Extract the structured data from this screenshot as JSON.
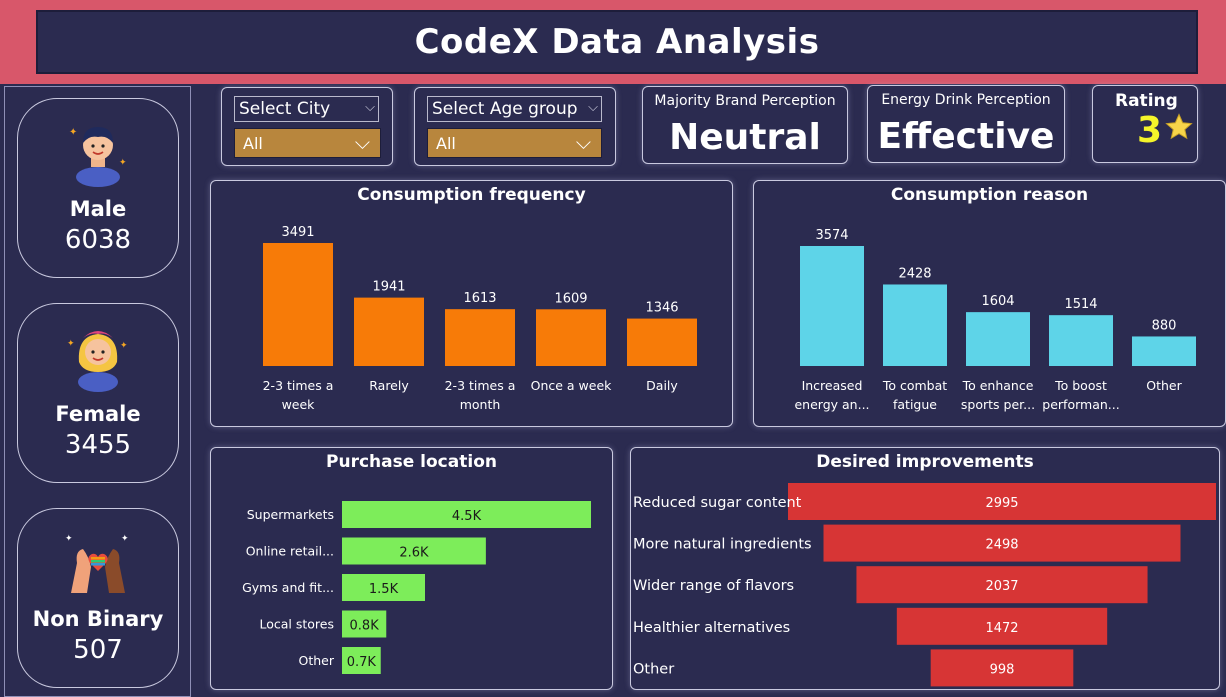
{
  "header": {
    "title": "CodeX Data Analysis"
  },
  "genders": [
    {
      "label": "Male",
      "value": "6038"
    },
    {
      "label": "Female",
      "value": "3455"
    },
    {
      "label": "Non Binary",
      "value": "507"
    }
  ],
  "filters": {
    "city": {
      "label": "Select City",
      "value": "All"
    },
    "age": {
      "label": "Select Age group",
      "value": "All"
    }
  },
  "kpis": {
    "brand": {
      "label": "Majority Brand Perception",
      "value": "Neutral"
    },
    "energy": {
      "label": "Energy Drink Perception",
      "value": "Effective"
    },
    "rating": {
      "label": "Rating",
      "value": "3",
      "icon": "star-icon"
    }
  },
  "colors": {
    "frequency": "#f77b08",
    "reason": "#5ed4e8",
    "location": "#7ded5a",
    "improvements": "#d73535"
  },
  "chart_data": [
    {
      "id": "frequency",
      "type": "bar",
      "title": "Consumption frequency",
      "categories": [
        "2-3 times a week",
        "Rarely",
        "2-3 times a month",
        "Once a week",
        "Daily"
      ],
      "category_lines": [
        [
          "2-3 times a",
          "week"
        ],
        [
          "Rarely"
        ],
        [
          "2-3 times a",
          "month"
        ],
        [
          "Once a week"
        ],
        [
          "Daily"
        ]
      ],
      "values": [
        3491,
        1941,
        1613,
        1609,
        1346
      ],
      "labels": [
        "3491",
        "1941",
        "1613",
        "1609",
        "1346"
      ]
    },
    {
      "id": "reason",
      "type": "bar",
      "title": "Consumption reason",
      "categories": [
        "Increased energy an...",
        "To combat fatigue",
        "To enhance sports per...",
        "To boost performan...",
        "Other"
      ],
      "category_lines": [
        [
          "Increased",
          "energy an..."
        ],
        [
          "To combat",
          "fatigue"
        ],
        [
          "To enhance",
          "sports per..."
        ],
        [
          "To boost",
          "performan..."
        ],
        [
          "Other"
        ]
      ],
      "values": [
        3574,
        2428,
        1604,
        1514,
        880
      ],
      "labels": [
        "3574",
        "2428",
        "1604",
        "1514",
        "880"
      ]
    },
    {
      "id": "location",
      "type": "bar",
      "orientation": "horizontal",
      "title": "Purchase location",
      "categories": [
        "Supermarkets",
        "Online retail...",
        "Gyms and fit...",
        "Local stores",
        "Other"
      ],
      "values": [
        4500,
        2600,
        1500,
        800,
        700
      ],
      "labels": [
        "4.5K",
        "2.6K",
        "1.5K",
        "0.8K",
        "0.7K"
      ]
    },
    {
      "id": "improvements",
      "type": "bar",
      "orientation": "funnel",
      "title": "Desired improvements",
      "categories": [
        "Reduced sugar content",
        "More natural ingredients",
        "Wider range of flavors",
        "Healthier alternatives",
        "Other"
      ],
      "values": [
        2995,
        2498,
        2037,
        1472,
        998
      ],
      "labels": [
        "2995",
        "2498",
        "2037",
        "1472",
        "998"
      ]
    }
  ]
}
